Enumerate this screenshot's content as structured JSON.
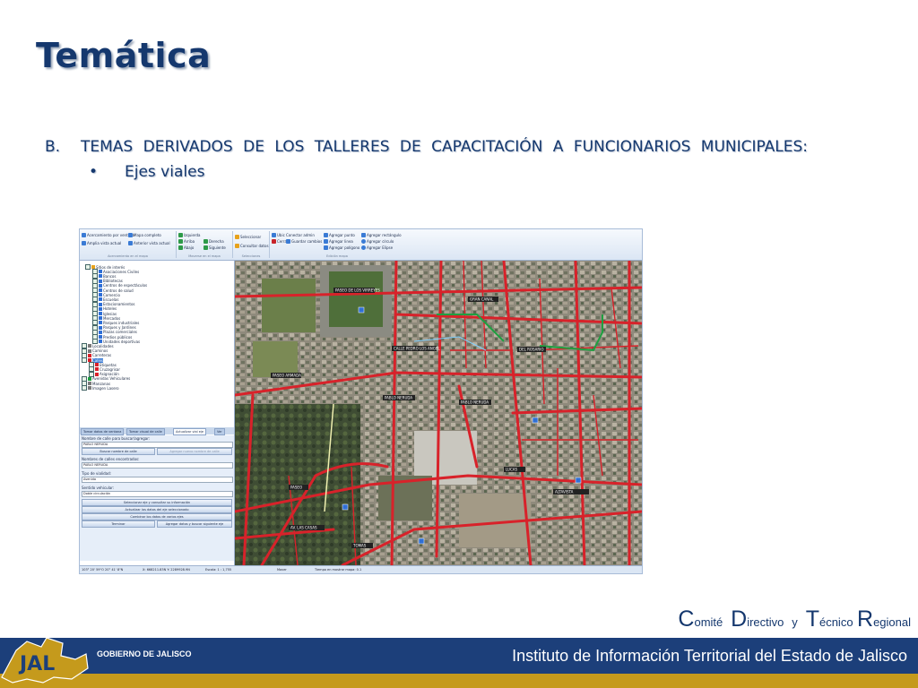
{
  "slide": {
    "title": "Temática",
    "paragraph_number": "B.",
    "paragraph_text": "TEMAS DERIVADOS DE LOS TALLERES DE CAPACITACIÓN A FUNCIONARIOS MUNICIPALES:",
    "bullet_symbol": "•",
    "bullet_text": "Ejes viales"
  },
  "app": {
    "ribbon": {
      "items": [
        "Acercamiento por ventana",
        "Mapa completo",
        "Amplia vista actual",
        "Anterior vista actual",
        "Izquierda",
        "Arriba",
        "Derecha",
        "Abajo",
        "Siguiente",
        "Seleccionar",
        "Consultar datos",
        "Ubic",
        "Cerrar",
        "Conectar admin",
        "Guardar cambios",
        "Agregar punto",
        "Agregar linea",
        "Agregar polígono",
        "Agregar rectángulo",
        "Agregar círculo",
        "Agregar Elipse"
      ],
      "captions": [
        "Acercamiento en el mapa",
        "Moverse en el mapa",
        "Selecciones",
        "Edición mapa"
      ]
    },
    "tree": {
      "nodes": [
        "Sitios de interés",
        "Asociaciones Civiles",
        "Bancos",
        "Bibliotecas",
        "Centros de espectáculos",
        "Centros de salud",
        "Comercio",
        "Escuelas",
        "Estacionamientos",
        "Hoteles",
        "Iglesias",
        "Mercados",
        "Parques industriales",
        "Parques y Jardines",
        "Plazas comerciales",
        "Predios públicos",
        "Unidades deportivas",
        "Localidades",
        "Caminos",
        "Carreteras",
        "Calles",
        "Etiquetas",
        "Cruzagrisar",
        "Asignación",
        "Avenidas Vehiculares",
        "Manzanas",
        "Imagen Lasero"
      ]
    },
    "tabs": [
      "Tomar datos de ventana",
      "Tomar visual de calle",
      "Actualizar vial eje",
      "Ver"
    ],
    "form": {
      "label_search": "Nombre de calle para buscar/agregar:",
      "value_search": "PABLO NERUDA",
      "btn_search": "Buscar nombre de calle",
      "btn_add": "Agregar nuevo nombre de calle",
      "label_found": "Nombres de calles encontrados:",
      "value_found": "PABLO NERUDA",
      "label_type": "Tipo de vialidad:",
      "value_type": "Avenida",
      "label_direction": "Sentido vehicular:",
      "value_direction": "Doble circulación",
      "btn_select": "Seleccionar eje y consultar su información",
      "btn_update": "Actualizar los datos del eje seleccionado",
      "btn_combine": "Combinar los datos de varios ejes",
      "btn_finish": "Terminar",
      "btn_next": "Agregar datos y buscar siguiente eje"
    },
    "map_labels": [
      "PASEO DE LOS VIRREYES",
      "PABLO NERUDA",
      "PABLO NERUDA",
      "CALLE PEDRO LOS ANGEL",
      "PASEO ARMADA",
      "GRAN CANAL",
      "DEL ROSARIO",
      "PASEO",
      "AV. LAS CASAS",
      "ALTAVISTA",
      "TOMAS",
      "LUCAS"
    ],
    "status": {
      "coords": "103° 20' 59\"O  20° 41' 8\"N",
      "xy": "X: 668211.83N   Y: 2289928.9N",
      "scale": "Escala: 1 : 1,755",
      "msg": "Tiempo en mostrar mapa: 0.1",
      "zoom": "Mover"
    }
  },
  "footer": {
    "ctr_c": "C",
    "ctr_omite": "omité",
    "ctr_d": "D",
    "ctr_irectivo": "irectivo",
    "ctr_y": "y",
    "ctr_t": "T",
    "ctr_ecnico": "écnico",
    "ctr_r": "R",
    "ctr_egional": "egional",
    "institute": "Instituto de Información Territorial del Estado de Jalisco",
    "gobierno": "GOBIERNO DE JALISCO",
    "logo_text": "JAL"
  },
  "colors": {
    "navy": "#15386e",
    "band": "#1c3f7a",
    "gold": "#c59a1c",
    "road": "#d8222a"
  }
}
